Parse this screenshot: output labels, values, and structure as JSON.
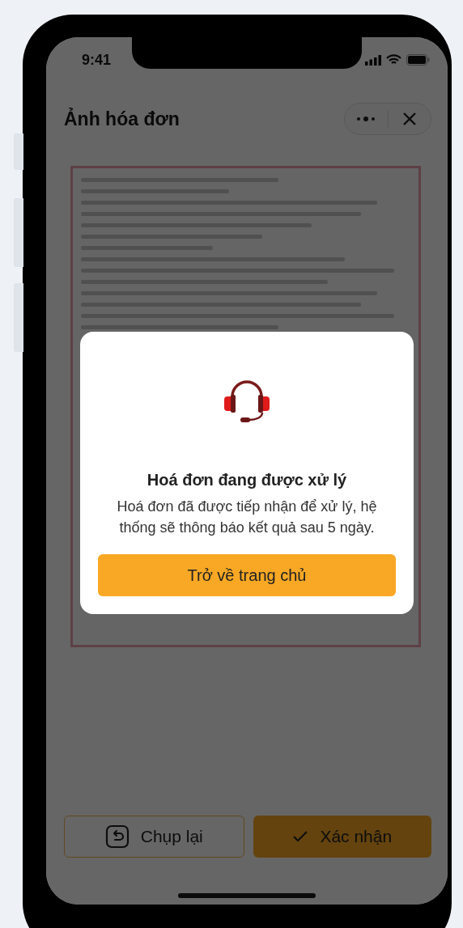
{
  "status_bar": {
    "time": "9:41"
  },
  "header": {
    "title": "Ảnh hóa đơn"
  },
  "actions": [
    {
      "label": "Chụp lại",
      "kind": "secondary"
    },
    {
      "label": "Xác nhận",
      "kind": "primary"
    }
  ],
  "dialog": {
    "title": "Hoá đơn đang được xử lý",
    "message": "Hoá đơn đã được tiếp nhận để xử lý, hệ thống sẽ thông báo kết quả sau 5 ngày.",
    "button": "Trở về trang chủ"
  }
}
